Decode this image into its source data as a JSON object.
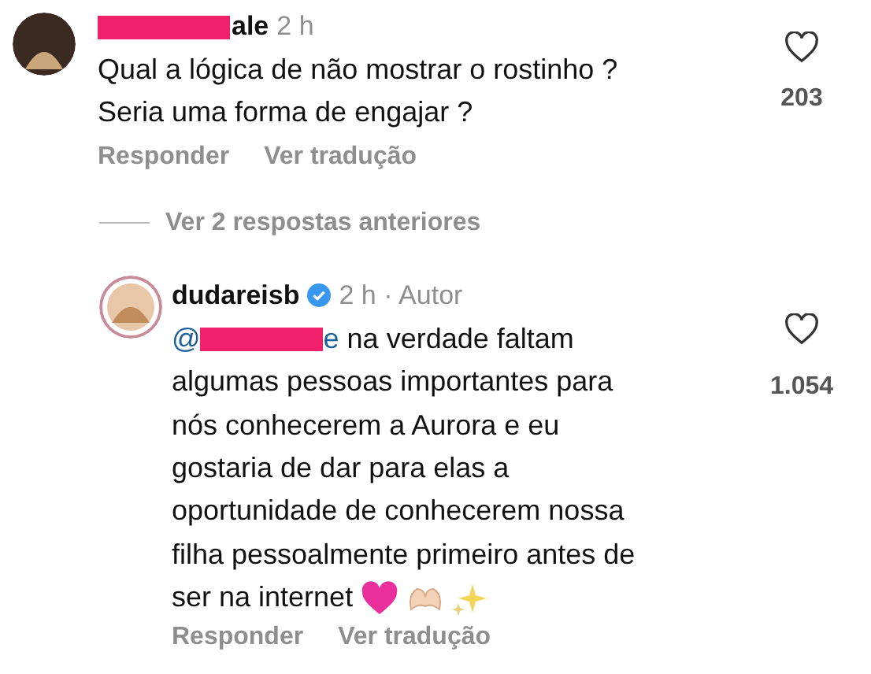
{
  "comment": {
    "redacted": true,
    "username_tail": "ale",
    "time": "2 h",
    "lines": [
      "Qual a lógica de não mostrar o rostinho ?",
      "Seria uma forma de engajar ?"
    ],
    "likes": "203",
    "actions": [
      "Responder",
      "Ver tradução"
    ]
  },
  "more_replies": "Ver 2 respostas anteriores",
  "reply": {
    "username": "dudareisb",
    "verified": true,
    "meta": "2 h · Autor",
    "mention_at": "@",
    "mention_redacted": true,
    "mention_tail": "e",
    "first_line": "na verdade faltam",
    "lines": [
      "algumas pessoas importantes para",
      "nós conhecerem a Aurora e eu",
      "gostaria de dar para elas a",
      "oportunidade de conhecerem nossa",
      "filha pessoalmente primeiro antes de",
      "ser na internet"
    ],
    "emojis": [
      {
        "kind": "heart"
      },
      {
        "kind": "hands"
      },
      {
        "kind": "sparkles"
      }
    ],
    "likes": "1.054",
    "actions": [
      "Responder",
      "Ver tradução"
    ]
  }
}
